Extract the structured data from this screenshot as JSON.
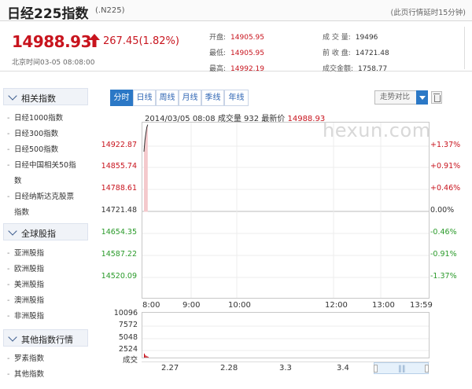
{
  "header": {
    "title": "日经225指数",
    "code": "(.N225)",
    "note": "(此页行情延时15分钟)"
  },
  "quote": {
    "price": "14988.93",
    "change": "267.45(1.82%)",
    "time": "北京时间03-05 08:08:00",
    "direction": "up",
    "stats": [
      {
        "label": "开盘:",
        "value": "14905.95",
        "red": true
      },
      {
        "label": "最低:",
        "value": "14905.95",
        "red": true
      },
      {
        "label": "最高:",
        "value": "14992.19",
        "red": true
      },
      {
        "label": "成 交 量:",
        "value": "19496",
        "red": false
      },
      {
        "label": "前 收 盘:",
        "value": "14721.48",
        "red": false
      },
      {
        "label": "成交金额:",
        "value": "1758.77",
        "red": false
      }
    ]
  },
  "sidebar": {
    "sections": [
      {
        "title": "相关指数",
        "items": [
          "日经1000指数",
          "日经300指数",
          "日经500指数",
          "日经中国相关50指",
          "数",
          "日经纳斯达克股票",
          "指数"
        ]
      },
      {
        "title": "全球股指",
        "items": [
          "亚洲股指",
          "欧洲股指",
          "美洲股指",
          "澳洲股指",
          "非洲股指"
        ]
      },
      {
        "title": "其他指数行情",
        "items": [
          "罗素指数",
          "其他指数"
        ]
      }
    ]
  },
  "chart": {
    "tabs": [
      "分时",
      "日线",
      "周线",
      "月线",
      "季线",
      "年线"
    ],
    "active_tab": "分时",
    "compare_label": "走势对比",
    "info": {
      "datetime": "2014/03/05 08:08",
      "volume_label": "成交量",
      "volume": "932",
      "last_label": "最新价",
      "last": "14988.93"
    },
    "logo": "hexun.com",
    "colors": {
      "up": "#c8141e",
      "down": "#2a9a2a",
      "accent": "#2b78c6"
    }
  },
  "chart_data": {
    "type": "line",
    "y_labels": [
      "14922.87",
      "14855.74",
      "14788.61",
      "14721.48",
      "14654.35",
      "14587.22",
      "14520.09"
    ],
    "pct_labels": [
      "+1.37%",
      "+0.91%",
      "+0.46%",
      "0.00%",
      "-0.46%",
      "-0.91%",
      "-1.37%"
    ],
    "x_labels": [
      "8:00",
      "9:00",
      "10:00",
      "12:00",
      "13:00",
      "13:59"
    ],
    "ylim": [
      14520.09,
      14988.93
    ],
    "series": [
      {
        "x": [
          "8:00",
          "8:02",
          "8:04",
          "8:06",
          "8:08"
        ],
        "values": [
          14905.95,
          14940.12,
          14961.55,
          14980.4,
          14988.93
        ]
      }
    ],
    "volume_labels": [
      "10096",
      "7572",
      "5048",
      "2524",
      "成交"
    ],
    "volume_values": [
      932,
      620,
      410,
      300,
      180
    ],
    "date_labels": [
      "2.27",
      "2.28",
      "3.3",
      "3.4"
    ]
  }
}
